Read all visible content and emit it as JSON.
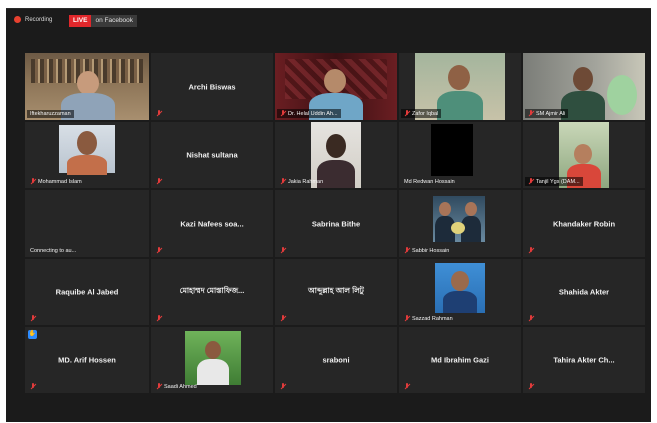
{
  "recording": {
    "label": "Recording"
  },
  "live": {
    "badge": "LIVE",
    "platform": "on Facebook"
  },
  "participants": [
    {
      "id": "p1",
      "name": "Iftekharuzzaman",
      "video": true,
      "active": true
    },
    {
      "id": "p2",
      "name": "Archi Biswas",
      "video": false
    },
    {
      "id": "p3",
      "name": "Dr. Helal Uddin Ah...",
      "video": true
    },
    {
      "id": "p4",
      "name": "Zafor Iqbal",
      "video": true
    },
    {
      "id": "p5",
      "name": "SM Ajmir Ali",
      "video": true
    },
    {
      "id": "p6",
      "name": "Mohammad Islam",
      "video": true
    },
    {
      "id": "p7",
      "name": "Nishat sultana",
      "video": false
    },
    {
      "id": "p8",
      "name": "Jakia Rahman",
      "video": true
    },
    {
      "id": "p9",
      "name": "Md Redwan Hossain",
      "video": true
    },
    {
      "id": "p10",
      "name": "Tanjil Ygs (DAM...",
      "video": true
    },
    {
      "id": "p11",
      "name": "Connecting to au...",
      "video": false,
      "connecting": true
    },
    {
      "id": "p12",
      "name": "Kazi Nafees soa...",
      "video": false
    },
    {
      "id": "p13",
      "name": "Sabrina Bithe",
      "video": false
    },
    {
      "id": "p14",
      "name": "Sabbir Hossain",
      "video": true
    },
    {
      "id": "p15",
      "name": "Khandaker Robin",
      "video": false
    },
    {
      "id": "p16",
      "name": "Raquibe Al Jabed",
      "video": false
    },
    {
      "id": "p17",
      "name": "মোহাম্মদ মোস্তাফিজ...",
      "video": false
    },
    {
      "id": "p18",
      "name": "আব্দুল্লাহ আল লিটু",
      "video": false
    },
    {
      "id": "p19",
      "name": "Sazzad Rahman",
      "video": true
    },
    {
      "id": "p20",
      "name": "Shahida Akter",
      "video": false
    },
    {
      "id": "p21",
      "name": "MD. Arif Hossen",
      "video": false,
      "hand": true
    },
    {
      "id": "p22",
      "name": "Saadi Ahmed",
      "video": true
    },
    {
      "id": "p23",
      "name": "sraboni",
      "video": false
    },
    {
      "id": "p24",
      "name": "Md Ibrahim Gazi",
      "video": false
    },
    {
      "id": "p25",
      "name": "Tahira Akter Ch...",
      "video": false
    }
  ]
}
